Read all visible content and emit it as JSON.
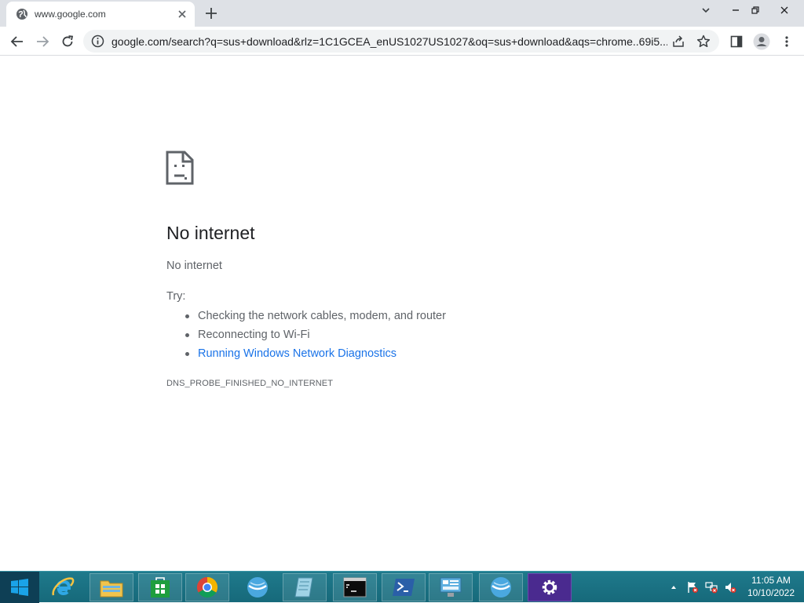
{
  "browser": {
    "tab": {
      "title": "www.google.com"
    },
    "url": "google.com/search?q=sus+download&rlz=1C1GCEA_enUS1027US1027&oq=sus+download&aqs=chrome..69i5..."
  },
  "error_page": {
    "title": "No internet",
    "subtitle": "No internet",
    "try_label": "Try:",
    "suggestions": [
      "Checking the network cables, modem, and router",
      "Reconnecting to Wi-Fi"
    ],
    "diagnostics_link": "Running Windows Network Diagnostics",
    "error_code": "DNS_PROBE_FINISHED_NO_INTERNET"
  },
  "taskbar": {
    "apps": [
      "internet-explorer",
      "file-explorer",
      "store",
      "chrome",
      "app-5",
      "app-6",
      "command-prompt",
      "powershell",
      "server-manager",
      "app-10",
      "settings"
    ],
    "clock": {
      "time": "11:05 AM",
      "date": "10/10/2022"
    }
  },
  "colors": {
    "link": "#1a73e8",
    "taskbar": "#16697a",
    "tabstrip": "#dee1e6"
  }
}
